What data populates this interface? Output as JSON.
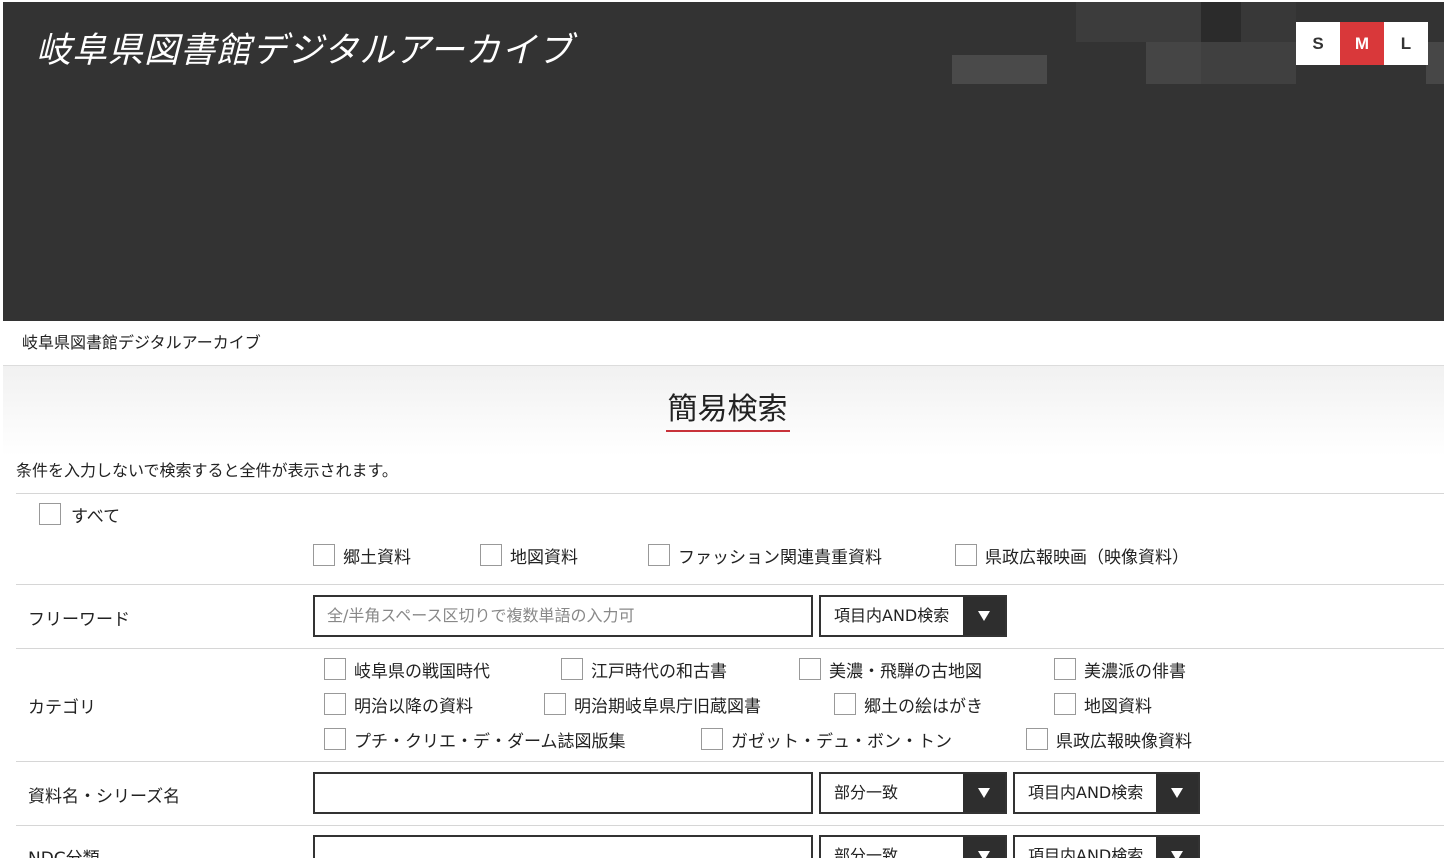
{
  "header": {
    "title": "岐阜県図書館デジタルアーカイブ",
    "font_sizes": [
      "S",
      "M",
      "L"
    ],
    "active_size": "M",
    "accent": "#d9383a",
    "bg": "#333333"
  },
  "breadcrumb": "岐阜県図書館デジタルアーカイブ",
  "panel": {
    "title": "簡易検索",
    "note": "条件を入力しないで検索すると全件が表示されます。"
  },
  "targets": {
    "all_label": "すべて",
    "items": [
      "郷土資料",
      "地図資料",
      "ファッション関連貴重資料",
      "県政広報映画（映像資料）"
    ]
  },
  "freeword": {
    "label": "フリーワード",
    "placeholder": "全/半角スペース区切りで複数単語の入力可",
    "mode": "項目内AND検索"
  },
  "category": {
    "label": "カテゴリ",
    "items": [
      "岐阜県の戦国時代",
      "江戸時代の和古書",
      "美濃・飛騨の古地図",
      "美濃派の俳書",
      "明治以降の資料",
      "明治期岐阜県庁旧蔵図書",
      "郷土の絵はがき",
      "地図資料",
      "プチ・クリエ・デ・ダーム誌図版集",
      "ガゼット・デュ・ボン・トン",
      "県政広報映像資料"
    ]
  },
  "title_row": {
    "label": "資料名・シリーズ名",
    "match": "部分一致",
    "mode": "項目内AND検索"
  },
  "ndc_row": {
    "label": "NDC分類",
    "match": "部分一致",
    "mode": "項目内AND検索"
  }
}
